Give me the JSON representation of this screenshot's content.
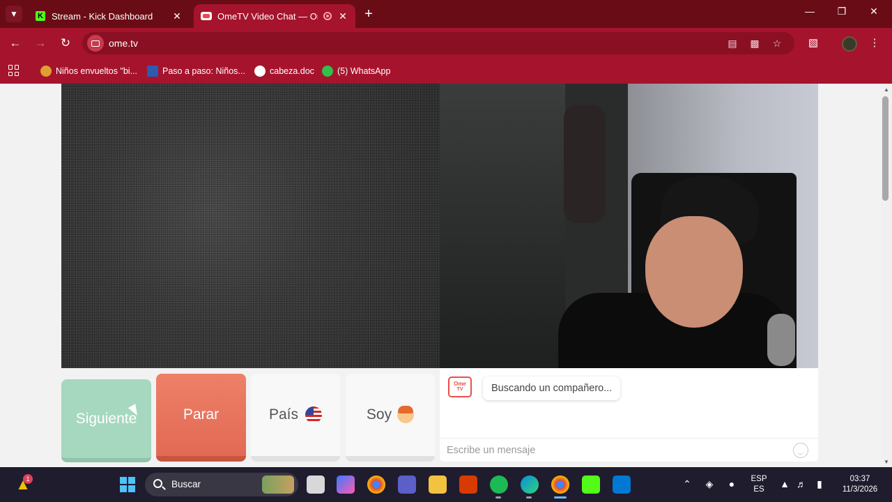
{
  "browser": {
    "tabs": [
      {
        "title": "Stream - Kick Dashboard",
        "favicon": "kick-icon",
        "active": false
      },
      {
        "title": "OmeTV Video Chat — Ome",
        "favicon": "ometv-icon",
        "active": true,
        "recording": true
      }
    ],
    "address": "ome.tv",
    "bookmarks": [
      {
        "label": "Niños envueltos \"bi...",
        "icon": "bookmark-avatar-icon"
      },
      {
        "label": "Paso a paso: Niños...",
        "icon": "bookmark-doc-icon"
      },
      {
        "label": "cabeza.doc",
        "icon": "bookmark-globe-icon"
      },
      {
        "label": "(5) WhatsApp",
        "icon": "whatsapp-icon"
      }
    ],
    "colors": {
      "frame": "#6a0c16",
      "toolbar": "#a5142c",
      "omnibox": "#8a0f22"
    }
  },
  "ometv": {
    "buttons": {
      "next": "Siguiente",
      "stop": "Parar",
      "country": "País",
      "gender": "Soy"
    },
    "chat": {
      "logo_top": "Ome",
      "logo_bottom": "TV",
      "status_message": "Buscando un compañero...",
      "input_placeholder": "Escribe un mensaje"
    },
    "colors": {
      "next": "#a6d8bf",
      "stop": "#e8735d",
      "neutral": "#f8f8f8"
    }
  },
  "taskbar": {
    "warning_badge": "1",
    "search_label": "Buscar",
    "language_top": "ESP",
    "language_bottom": "ES",
    "time": "03:37",
    "date": "11/3/2026"
  }
}
